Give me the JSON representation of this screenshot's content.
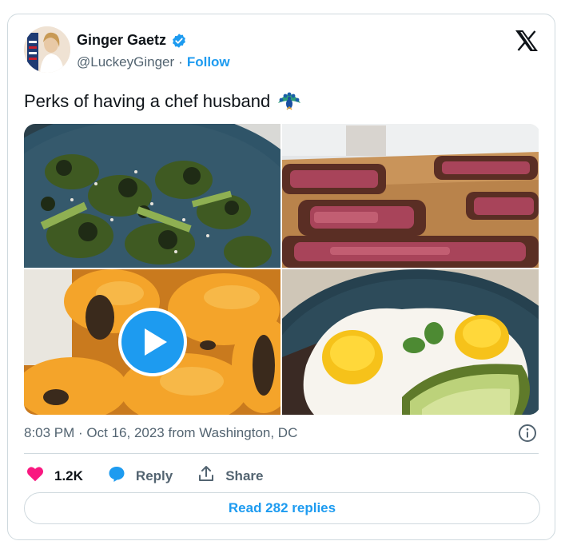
{
  "author": {
    "name": "Ginger Gaetz",
    "handle": "@LuckeyGinger",
    "separator": "·",
    "follow_label": "Follow"
  },
  "tweet": {
    "text": "Perks of having a chef husband",
    "emoji_icon": "peacock-icon"
  },
  "media": {
    "tiles": [
      "broccoli-photo",
      "steak-photo",
      "peppers-video",
      "eggs-avocado-photo"
    ],
    "play_icon": "play-icon"
  },
  "meta": {
    "timestamp": "8:03 PM · Oct 16, 2023 from Washington, DC"
  },
  "actions": {
    "like_count": "1.2K",
    "reply_label": "Reply",
    "share_label": "Share"
  },
  "read_replies_label": "Read 282 replies",
  "colors": {
    "accent": "#1d9bf0",
    "heart": "#f91880",
    "text": "#0f1419",
    "muted": "#536471",
    "border": "#cfd9de"
  }
}
